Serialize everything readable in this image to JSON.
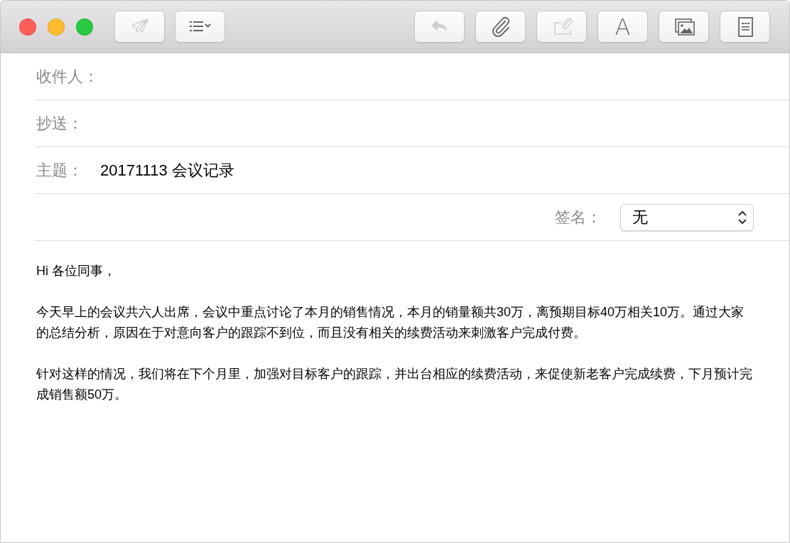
{
  "window": {
    "controls": [
      {
        "color": "#ff5f57"
      },
      {
        "color": "#febc2e"
      },
      {
        "color": "#28c840"
      }
    ]
  },
  "toolbar": {
    "left": [
      {
        "kind": "send",
        "disabled": true
      },
      {
        "kind": "list",
        "disabled": false
      }
    ],
    "right": [
      {
        "kind": "reply",
        "disabled": true
      },
      {
        "kind": "attach",
        "disabled": false
      },
      {
        "kind": "markup",
        "disabled": true
      },
      {
        "kind": "font",
        "label": "A",
        "disabled": false
      },
      {
        "kind": "photos",
        "disabled": false
      },
      {
        "kind": "template",
        "disabled": false
      }
    ]
  },
  "fields": [
    {
      "label": "收件人："
    },
    {
      "label": "抄送："
    },
    {
      "label": "主题：",
      "value": "20171113 会议记录"
    }
  ],
  "signature": {
    "label": "签名：",
    "value": "无"
  },
  "body": [
    "Hi 各位同事，",
    "今天早上的会议共六人出席，会议中重点讨论了本月的销售情况，本月的销量额共30万，离预期目标40万相关10万。通过大家的总结分析，原因在于对意向客户的跟踪不到位，而且没有相关的续费活动来刺激客户完成付费。",
    "针对这样的情况，我们将在下个月里，加强对目标客户的跟踪，并出台相应的续费活动，来促使新老客户完成续费，下月预计完成销售额50万。"
  ]
}
